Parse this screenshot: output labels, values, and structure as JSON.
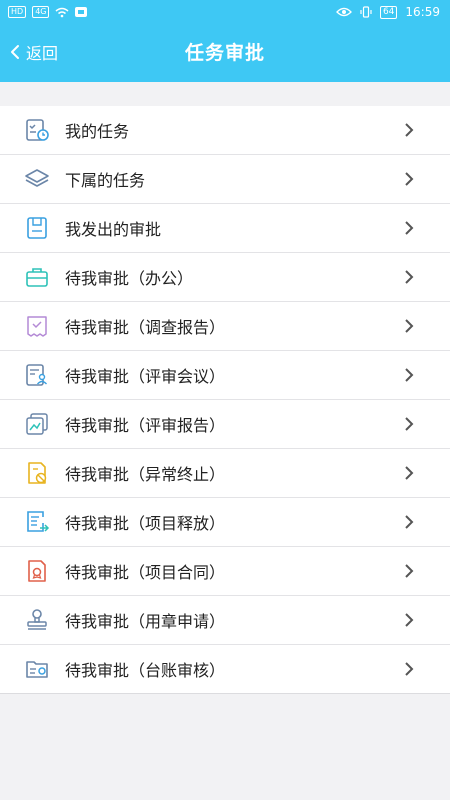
{
  "status_bar": {
    "left_chips": [
      "HD",
      "4G"
    ],
    "time": "16:59",
    "battery": "64"
  },
  "header": {
    "back_label": "返回",
    "title": "任务审批"
  },
  "colors": {
    "header_bg": "#3ec8f4",
    "page_bg": "#f2f2f4"
  },
  "menu": {
    "items": [
      {
        "label": "我的任务",
        "icon": "task-checklist-clock-icon"
      },
      {
        "label": "下属的任务",
        "icon": "layers-icon"
      },
      {
        "label": "我发出的审批",
        "icon": "document-sent-icon"
      },
      {
        "label": "待我审批（办公）",
        "icon": "briefcase-icon"
      },
      {
        "label": "待我审批（调查报告）",
        "icon": "report-check-icon"
      },
      {
        "label": "待我审批（评审会议）",
        "icon": "meeting-review-icon"
      },
      {
        "label": "待我审批（评审报告）",
        "icon": "chart-report-icon"
      },
      {
        "label": "待我审批（异常终止）",
        "icon": "abnormal-stop-icon"
      },
      {
        "label": "待我审批（项目释放）",
        "icon": "project-release-icon"
      },
      {
        "label": "待我审批（项目合同）",
        "icon": "contract-seal-icon"
      },
      {
        "label": "待我审批（用章申请）",
        "icon": "stamp-icon"
      },
      {
        "label": "待我审批（台账审核）",
        "icon": "ledger-audit-icon"
      }
    ]
  }
}
